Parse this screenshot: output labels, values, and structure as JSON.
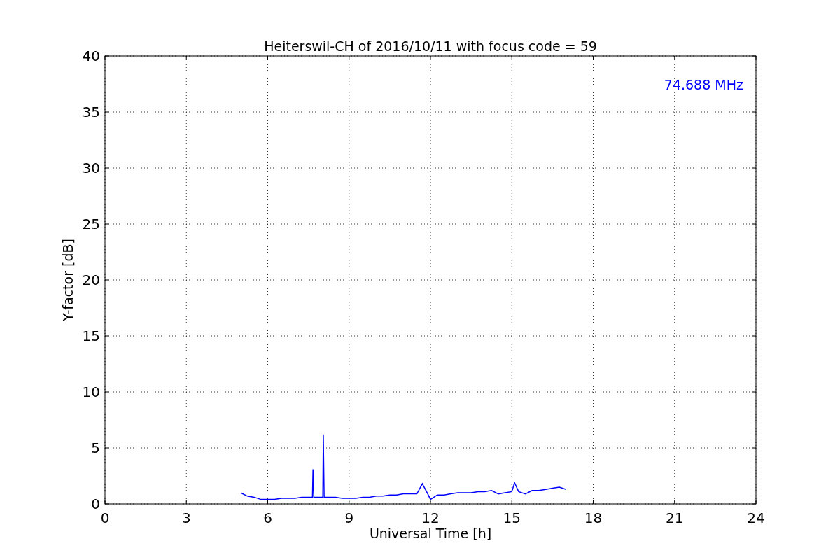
{
  "chart": {
    "chart_data": {
      "type": "line",
      "title": "Heiterswil-CH of 2016/10/11 with focus code = 59",
      "xlabel": "Universal Time [h]",
      "ylabel": "Y-factor [dB]",
      "x": [
        5,
        5.25,
        5.5,
        5.75,
        6,
        6.25,
        6.5,
        6.75,
        7,
        7.25,
        7.5,
        7.65,
        7.67,
        7.7,
        8,
        8.03,
        8.05,
        8.08,
        8.25,
        8.5,
        8.75,
        9,
        9.25,
        9.5,
        9.75,
        10,
        10.25,
        10.5,
        10.75,
        11,
        11.25,
        11.5,
        11.7,
        11.9,
        12,
        12.25,
        12.5,
        12.75,
        13,
        13.25,
        13.5,
        13.75,
        14,
        14.25,
        14.5,
        14.75,
        15,
        15.1,
        15.25,
        15.5,
        15.75,
        16,
        16.25,
        16.5,
        16.75,
        17
      ],
      "series": [
        {
          "color": "#0000ff",
          "values": [
            1.0,
            0.7,
            0.6,
            0.4,
            0.4,
            0.4,
            0.5,
            0.5,
            0.5,
            0.6,
            0.6,
            0.6,
            3.1,
            0.6,
            0.6,
            0.6,
            6.2,
            0.6,
            0.6,
            0.6,
            0.5,
            0.5,
            0.5,
            0.6,
            0.6,
            0.7,
            0.7,
            0.8,
            0.8,
            0.9,
            0.9,
            0.9,
            1.8,
            0.9,
            0.4,
            0.8,
            0.8,
            0.9,
            1.0,
            1.0,
            1.0,
            1.1,
            1.1,
            1.2,
            0.9,
            1.0,
            1.1,
            1.9,
            1.1,
            0.9,
            1.2,
            1.2,
            1.3,
            1.4,
            1.5,
            1.3
          ]
        }
      ],
      "xlim": [
        0,
        24
      ],
      "ylim": [
        0,
        40
      ],
      "xticks": [
        0,
        3,
        6,
        9,
        12,
        15,
        18,
        21,
        24
      ],
      "yticks": [
        0,
        5,
        10,
        15,
        20,
        25,
        30,
        35,
        40
      ],
      "grid": true,
      "annotations": [
        "74.688 MHz"
      ]
    }
  }
}
